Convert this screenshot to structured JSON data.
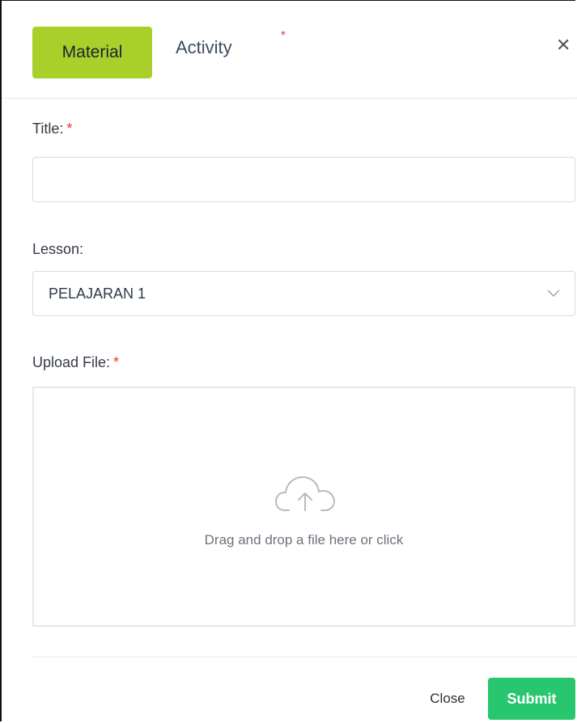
{
  "tabs": {
    "material_label": "Material",
    "activity_label": "Activity",
    "required_marker": "*"
  },
  "form": {
    "title": {
      "label": "Title:",
      "required_marker": "*",
      "value": ""
    },
    "lesson": {
      "label": "Lesson:",
      "selected": "PELAJARAN 1"
    },
    "upload": {
      "label": "Upload File:",
      "required_marker": "*",
      "hint": "Drag and drop a file here or click"
    }
  },
  "footer": {
    "close_label": "Close",
    "submit_label": "Submit"
  },
  "icons": {
    "close": "close-icon",
    "chevron": "chevron-down-icon",
    "upload": "cloud-upload-icon"
  },
  "colors": {
    "active_tab": "#a8cf2a",
    "submit": "#28c76f",
    "required": "#e53935"
  }
}
